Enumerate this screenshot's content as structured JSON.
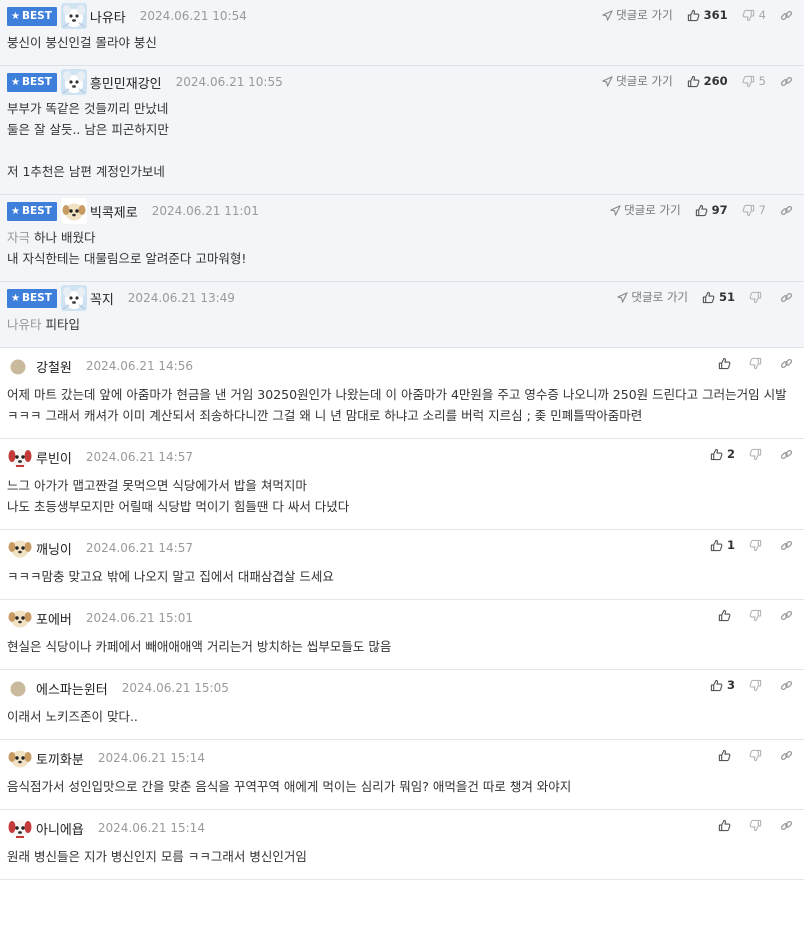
{
  "labels": {
    "best": "BEST",
    "reply": "댓글로 가기"
  },
  "icons": {
    "best_star": "star-icon",
    "reply": "reply-arrow-icon",
    "upvote": "thumbs-up-icon",
    "downvote": "thumbs-down-icon",
    "share": "link-icon"
  },
  "colors": {
    "best_badge": "#3f7fdc",
    "best_row_bg": "#f3f5f9"
  },
  "comments": [
    {
      "best": true,
      "avatar": "white-dog",
      "nick": "나유타",
      "date": "2024.06.21 10:54",
      "show_reply": true,
      "up": "361",
      "down": "4",
      "mention": "",
      "body": "붕신이 붕신인걸 몰라야 붕신"
    },
    {
      "best": true,
      "avatar": "white-dog",
      "nick": "흥민민재강인",
      "date": "2024.06.21 10:55",
      "show_reply": true,
      "up": "260",
      "down": "5",
      "mention": "",
      "body": "부부가 똑같은 것들끼리 만났네\n둘은 잘 살듯.. 남은 피곤하지만\n\n저 1추천은 남편 계정인가보네"
    },
    {
      "best": true,
      "avatar": "puppy",
      "nick": "빅콕제로",
      "date": "2024.06.21 11:01",
      "show_reply": true,
      "up": "97",
      "down": "7",
      "mention": "자극",
      "body": " 하나 배웠다\n내 자식한테는 대물림으로 알려준다 고마워형!"
    },
    {
      "best": true,
      "avatar": "white-dog",
      "nick": "꼭지",
      "date": "2024.06.21 13:49",
      "show_reply": true,
      "up": "51",
      "down": "",
      "mention": "나유타",
      "body": " 피타입"
    },
    {
      "best": false,
      "avatar": "beige-circle",
      "nick": "강철원",
      "date": "2024.06.21 14:56",
      "show_reply": false,
      "up": "",
      "down": "",
      "mention": "",
      "body": "어제 마트 갔는데 앞에 아줌마가 현금을 낸 거임 30250원인가 나왔는데 이 아줌마가 4만원을 주고 영수증 나오니까 250원 드린다고 그러는거임 시발 ㅋㅋㅋ 그래서 캐셔가 이미 계산되서 죄송하다니깐 그걸 왜 니 년 맘대로 하냐고 소리를 버럭 지르심 ; 좆 민폐틀딱아줌마련"
    },
    {
      "best": false,
      "avatar": "red-dog",
      "nick": "루빈이",
      "date": "2024.06.21 14:57",
      "show_reply": false,
      "up": "2",
      "down": "",
      "mention": "",
      "body": "느그 아가가 맵고짠걸 못먹으면 식당에가서 밥을 쳐먹지마\n나도 초등생부모지만 어릴때 식당밥 먹이기 힘들땐 다 싸서 다녔다"
    },
    {
      "best": false,
      "avatar": "puppy",
      "nick": "깨닝이",
      "date": "2024.06.21 14:57",
      "show_reply": false,
      "up": "1",
      "down": "",
      "mention": "",
      "body": "ㅋㅋㅋ맘충 맞고요 밖에 나오지 말고 집에서 대패삼겹살 드세요"
    },
    {
      "best": false,
      "avatar": "puppy",
      "nick": "포에버",
      "date": "2024.06.21 15:01",
      "show_reply": false,
      "up": "",
      "down": "",
      "mention": "",
      "body": "현실은 식당이나 카페에서 빼애애애액 거리는거 방치하는 씹부모들도 많음"
    },
    {
      "best": false,
      "avatar": "beige-circle",
      "nick": "에스파는윈터",
      "date": "2024.06.21 15:05",
      "show_reply": false,
      "up": "3",
      "down": "",
      "mention": "",
      "body": "이래서 노키즈존이 맞다.."
    },
    {
      "best": false,
      "avatar": "puppy",
      "nick": "토끼화분",
      "date": "2024.06.21 15:14",
      "show_reply": false,
      "up": "",
      "down": "",
      "mention": "",
      "body": "음식점가서 성인입맛으로 간을 맞춘 음식을 꾸역꾸역 애에게 먹이는 심리가 뭐임? 애먹을건 따로 챙겨 와야지"
    },
    {
      "best": false,
      "avatar": "red-dog",
      "nick": "아니에욥",
      "date": "2024.06.21 15:14",
      "show_reply": false,
      "up": "",
      "down": "",
      "mention": "",
      "body": "원래 병신들은 지가 병신인지 모름 ㅋㅋ그래서 병신인거임"
    }
  ]
}
